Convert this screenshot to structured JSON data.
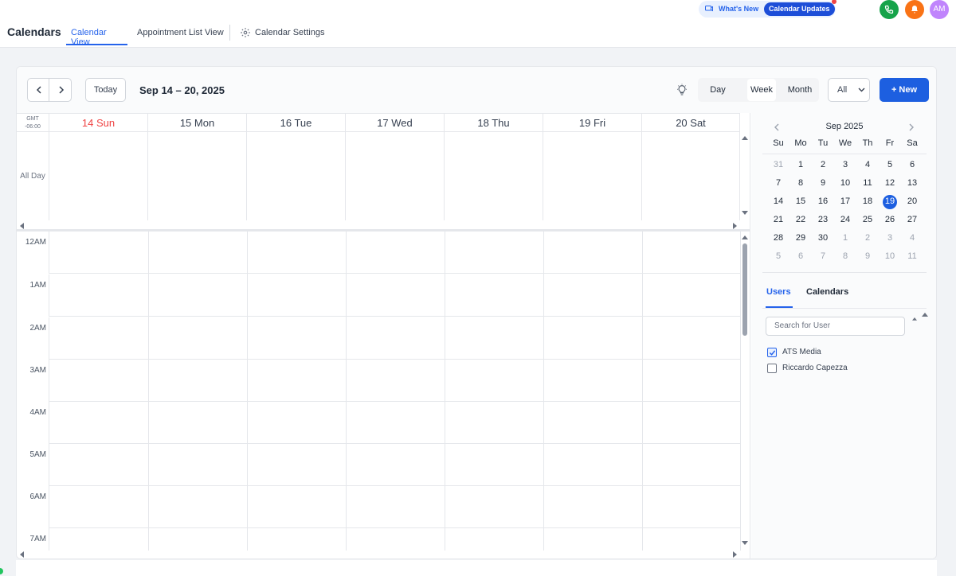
{
  "header": {
    "title": "Calendars",
    "tabs": [
      {
        "label": "Calendar View",
        "active": true
      },
      {
        "label": "Appointment List View",
        "active": false
      }
    ],
    "settings_label": "Calendar Settings",
    "whats_new_label": "What's New",
    "updates_pill": "Calendar Updates",
    "avatar_initials": "AM"
  },
  "toolbar": {
    "today_label": "Today",
    "range_label": "Sep 14 – 20, 2025",
    "views": [
      "Day",
      "Week",
      "Month"
    ],
    "active_view": "Week",
    "filter_value": "All",
    "new_label": "+ New"
  },
  "grid": {
    "timezone_line1": "GMT",
    "timezone_line2": "-06:00",
    "days": [
      "14 Sun",
      "15 Mon",
      "16 Tue",
      "17 Wed",
      "18 Thu",
      "19 Fri",
      "20 Sat"
    ],
    "all_day_label": "All Day",
    "hours": [
      "12AM",
      "1AM",
      "2AM",
      "3AM",
      "4AM",
      "5AM",
      "6AM",
      "7AM"
    ]
  },
  "mini_calendar": {
    "month_label": "Sep 2025",
    "weekdays": [
      "Su",
      "Mo",
      "Tu",
      "We",
      "Th",
      "Fr",
      "Sa"
    ],
    "weeks": [
      [
        "31",
        "1",
        "2",
        "3",
        "4",
        "5",
        "6"
      ],
      [
        "7",
        "8",
        "9",
        "10",
        "11",
        "12",
        "13"
      ],
      [
        "14",
        "15",
        "16",
        "17",
        "18",
        "19",
        "20"
      ],
      [
        "21",
        "22",
        "23",
        "24",
        "25",
        "26",
        "27"
      ],
      [
        "28",
        "29",
        "30",
        "1",
        "2",
        "3",
        "4"
      ],
      [
        "5",
        "6",
        "7",
        "8",
        "9",
        "10",
        "11"
      ]
    ],
    "selected": "19"
  },
  "panel": {
    "tabs": [
      "Users",
      "Calendars"
    ],
    "active_tab": "Users",
    "search_placeholder": "Search for User",
    "users": [
      {
        "name": "ATS Media",
        "checked": true
      },
      {
        "name": "Riccardo Capezza",
        "checked": false
      }
    ]
  },
  "colors": {
    "accent": "#2563eb",
    "primary_button": "#1d5fe0",
    "sunday": "#ef4444"
  }
}
